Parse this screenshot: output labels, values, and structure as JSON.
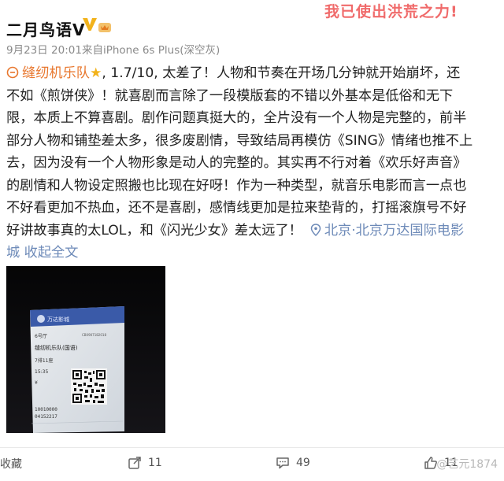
{
  "post": {
    "username": "二月鸟语V",
    "badge_verified": "V",
    "banner": "我已使出洪荒之力!",
    "date": "9月23日 20:01",
    "source_prefix": "来自",
    "device": "iPhone 6s Plus(深空灰)",
    "lines": [
      "缝纫机乐队",
      ", 1.7/10, 太差了！人物和节奏在开场几分钟就开始崩坏，还",
      "不如《煎饼侠》！就喜剧而言除了一段模版套的不错以外基本是低俗和无下",
      "限，本质上不算喜剧。剧作问题真挺大的，全片没有一个人物是完整的，前半",
      "部分人物和铺垫差太多，很多废剧情，导致结局再模仿《SING》情绪也推不上",
      "去，因为没有一个人物形象是动人的完整的。其实再不行对着《欢乐好声音》",
      "的剧情和人物设定照搬也比现在好呀！作为一种类型，就音乐电影而言一点也",
      "不好看更加不热血，还不是喜剧，感情线更加是拉来垫背的，打摇滚旗号不好",
      "好讲故事真的太LOL，和《闪光少女》差太远了！",
      "北京·北京万达国际电影",
      "城",
      "收起全文"
    ],
    "ticket": {
      "cinema": "万达影城",
      "hall": "6号厅",
      "movie": "缝纫机乐队(国语)",
      "seat": "7排11座",
      "time": "15:35",
      "price": "¥",
      "code1": "10010000",
      "code2": "04152217",
      "ticket_no": "CB0907182018"
    }
  },
  "footer": {
    "collect_label": "收藏",
    "repost_count": "11",
    "comment_count": "49",
    "like_count": "11",
    "watermark": "@艺元1874"
  },
  "colors": {
    "link": "#6d8ab8",
    "tag": "#e8772e",
    "banner": "#f06b6b",
    "verified": "#f2b21a"
  }
}
